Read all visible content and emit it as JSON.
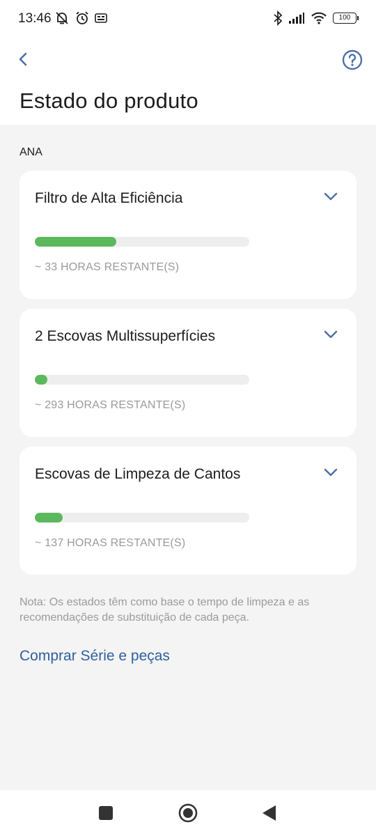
{
  "status_bar": {
    "time": "13:46",
    "battery": "100",
    "icons": [
      "do-not-disturb-icon",
      "alarm-icon",
      "notification-icon",
      "bluetooth-icon",
      "signal-icon",
      "wifi-icon",
      "battery-icon"
    ]
  },
  "header": {
    "title": "Estado do produto",
    "back_icon": "chevron-left-icon",
    "help_icon": "help-circle-icon"
  },
  "section": {
    "label": "ANA"
  },
  "parts": [
    {
      "name": "Filtro de Alta Eficiência",
      "remaining": "~ 33 HORAS RESTANTE(S)",
      "progress": 0.38
    },
    {
      "name": "2 Escovas Multissuperfícies",
      "remaining": "~ 293 HORAS RESTANTE(S)",
      "progress": 0.06
    },
    {
      "name": "Escovas de Limpeza de Cantos",
      "remaining": "~ 137 HORAS RESTANTE(S)",
      "progress": 0.13
    }
  ],
  "note": "Nota: Os estados têm como base o tempo de limpeza e as recomendações de substituição de cada peça.",
  "buy_link": "Comprar Série e peças",
  "colors": {
    "progress_fill": "#5cb85c",
    "link": "#2f5fa0",
    "icon_accent": "#4a6fa5"
  },
  "nav_bar": {
    "icons": [
      "recents-square-icon",
      "home-circle-icon",
      "back-triangle-icon"
    ]
  }
}
